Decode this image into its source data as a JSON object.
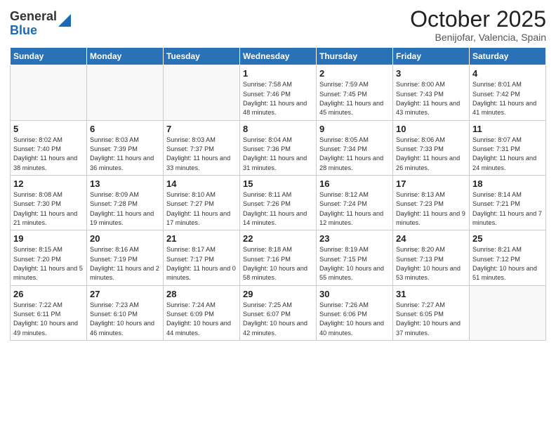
{
  "header": {
    "logo_line1": "General",
    "logo_line2": "Blue",
    "month": "October 2025",
    "location": "Benijofar, Valencia, Spain"
  },
  "weekdays": [
    "Sunday",
    "Monday",
    "Tuesday",
    "Wednesday",
    "Thursday",
    "Friday",
    "Saturday"
  ],
  "weeks": [
    [
      {
        "day": "",
        "info": ""
      },
      {
        "day": "",
        "info": ""
      },
      {
        "day": "",
        "info": ""
      },
      {
        "day": "1",
        "info": "Sunrise: 7:58 AM\nSunset: 7:46 PM\nDaylight: 11 hours\nand 48 minutes."
      },
      {
        "day": "2",
        "info": "Sunrise: 7:59 AM\nSunset: 7:45 PM\nDaylight: 11 hours\nand 45 minutes."
      },
      {
        "day": "3",
        "info": "Sunrise: 8:00 AM\nSunset: 7:43 PM\nDaylight: 11 hours\nand 43 minutes."
      },
      {
        "day": "4",
        "info": "Sunrise: 8:01 AM\nSunset: 7:42 PM\nDaylight: 11 hours\nand 41 minutes."
      }
    ],
    [
      {
        "day": "5",
        "info": "Sunrise: 8:02 AM\nSunset: 7:40 PM\nDaylight: 11 hours\nand 38 minutes."
      },
      {
        "day": "6",
        "info": "Sunrise: 8:03 AM\nSunset: 7:39 PM\nDaylight: 11 hours\nand 36 minutes."
      },
      {
        "day": "7",
        "info": "Sunrise: 8:03 AM\nSunset: 7:37 PM\nDaylight: 11 hours\nand 33 minutes."
      },
      {
        "day": "8",
        "info": "Sunrise: 8:04 AM\nSunset: 7:36 PM\nDaylight: 11 hours\nand 31 minutes."
      },
      {
        "day": "9",
        "info": "Sunrise: 8:05 AM\nSunset: 7:34 PM\nDaylight: 11 hours\nand 28 minutes."
      },
      {
        "day": "10",
        "info": "Sunrise: 8:06 AM\nSunset: 7:33 PM\nDaylight: 11 hours\nand 26 minutes."
      },
      {
        "day": "11",
        "info": "Sunrise: 8:07 AM\nSunset: 7:31 PM\nDaylight: 11 hours\nand 24 minutes."
      }
    ],
    [
      {
        "day": "12",
        "info": "Sunrise: 8:08 AM\nSunset: 7:30 PM\nDaylight: 11 hours\nand 21 minutes."
      },
      {
        "day": "13",
        "info": "Sunrise: 8:09 AM\nSunset: 7:28 PM\nDaylight: 11 hours\nand 19 minutes."
      },
      {
        "day": "14",
        "info": "Sunrise: 8:10 AM\nSunset: 7:27 PM\nDaylight: 11 hours\nand 17 minutes."
      },
      {
        "day": "15",
        "info": "Sunrise: 8:11 AM\nSunset: 7:26 PM\nDaylight: 11 hours\nand 14 minutes."
      },
      {
        "day": "16",
        "info": "Sunrise: 8:12 AM\nSunset: 7:24 PM\nDaylight: 11 hours\nand 12 minutes."
      },
      {
        "day": "17",
        "info": "Sunrise: 8:13 AM\nSunset: 7:23 PM\nDaylight: 11 hours\nand 9 minutes."
      },
      {
        "day": "18",
        "info": "Sunrise: 8:14 AM\nSunset: 7:21 PM\nDaylight: 11 hours\nand 7 minutes."
      }
    ],
    [
      {
        "day": "19",
        "info": "Sunrise: 8:15 AM\nSunset: 7:20 PM\nDaylight: 11 hours\nand 5 minutes."
      },
      {
        "day": "20",
        "info": "Sunrise: 8:16 AM\nSunset: 7:19 PM\nDaylight: 11 hours\nand 2 minutes."
      },
      {
        "day": "21",
        "info": "Sunrise: 8:17 AM\nSunset: 7:17 PM\nDaylight: 11 hours\nand 0 minutes."
      },
      {
        "day": "22",
        "info": "Sunrise: 8:18 AM\nSunset: 7:16 PM\nDaylight: 10 hours\nand 58 minutes."
      },
      {
        "day": "23",
        "info": "Sunrise: 8:19 AM\nSunset: 7:15 PM\nDaylight: 10 hours\nand 55 minutes."
      },
      {
        "day": "24",
        "info": "Sunrise: 8:20 AM\nSunset: 7:13 PM\nDaylight: 10 hours\nand 53 minutes."
      },
      {
        "day": "25",
        "info": "Sunrise: 8:21 AM\nSunset: 7:12 PM\nDaylight: 10 hours\nand 51 minutes."
      }
    ],
    [
      {
        "day": "26",
        "info": "Sunrise: 7:22 AM\nSunset: 6:11 PM\nDaylight: 10 hours\nand 49 minutes."
      },
      {
        "day": "27",
        "info": "Sunrise: 7:23 AM\nSunset: 6:10 PM\nDaylight: 10 hours\nand 46 minutes."
      },
      {
        "day": "28",
        "info": "Sunrise: 7:24 AM\nSunset: 6:09 PM\nDaylight: 10 hours\nand 44 minutes."
      },
      {
        "day": "29",
        "info": "Sunrise: 7:25 AM\nSunset: 6:07 PM\nDaylight: 10 hours\nand 42 minutes."
      },
      {
        "day": "30",
        "info": "Sunrise: 7:26 AM\nSunset: 6:06 PM\nDaylight: 10 hours\nand 40 minutes."
      },
      {
        "day": "31",
        "info": "Sunrise: 7:27 AM\nSunset: 6:05 PM\nDaylight: 10 hours\nand 37 minutes."
      },
      {
        "day": "",
        "info": ""
      }
    ]
  ]
}
